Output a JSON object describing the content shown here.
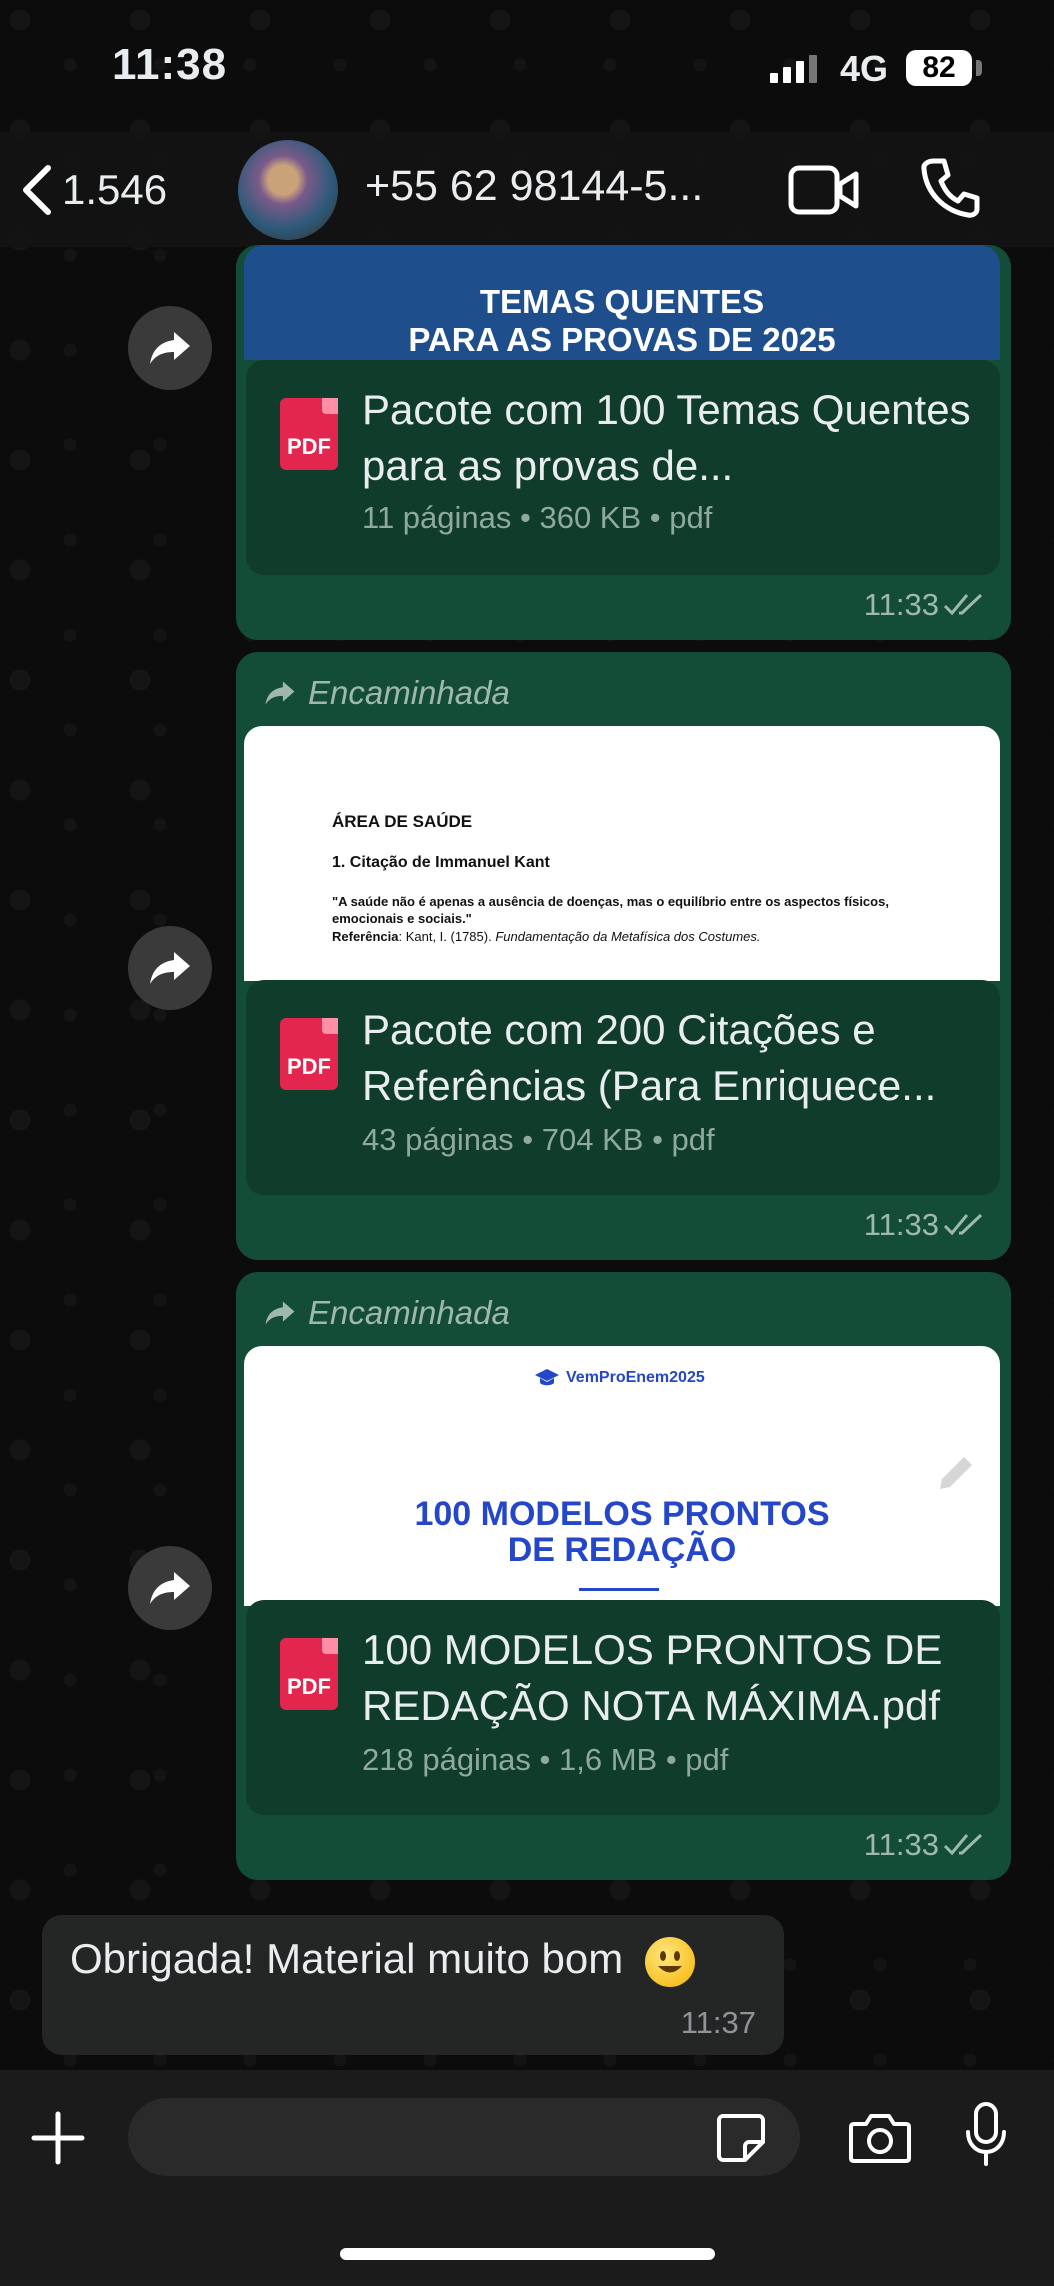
{
  "status_bar": {
    "time": "11:38",
    "network": "4G",
    "battery": "82"
  },
  "header": {
    "back_count": "1.546",
    "contact_name": "+55 62 98144-5..."
  },
  "messages": [
    {
      "preview_banner": [
        "TEMAS QUENTES",
        "PARA AS PROVAS DE 2025"
      ],
      "doc_title": "Pacote com 100 Temas Quentes para as provas de...",
      "doc_meta": "11 páginas • 360 KB • pdf",
      "time": "11:33"
    },
    {
      "forwarded_label": "Encaminhada",
      "preview_lines": {
        "heading": "ÁREA DE SAÚDE",
        "subheading": "1. Citação de Immanuel Kant",
        "quote": "\"A saúde não é apenas a ausência de doenças, mas o equilíbrio entre os aspectos físicos, emocionais e sociais.\"",
        "reference_label": "Referência",
        "reference_text": ": Kant, I. (1785). ",
        "reference_italic": "Fundamentação da Metafísica dos Costumes."
      },
      "doc_title": "Pacote com 200 Citações e Referências (Para Enriquece...",
      "doc_meta": "43 páginas • 704 KB • pdf",
      "time": "11:33"
    },
    {
      "forwarded_label": "Encaminhada",
      "preview_brand": "VemProEnem2025",
      "preview_title": [
        "100 MODELOS PRONTOS",
        "DE REDAÇÃO"
      ],
      "doc_title": "100 MODELOS PRONTOS DE REDAÇÃO NOTA MÁXIMA.pdf",
      "doc_meta": "218 páginas • 1,6 MB • pdf",
      "time": "11:33"
    }
  ],
  "received": {
    "text": "Obrigada! Material muito bom",
    "emoji": "😃",
    "time": "11:37"
  },
  "pdf_label": "PDF",
  "colors": {
    "sent_bubble": "#144d37",
    "received_bubble": "#242626",
    "pdf_red": "#e2264d",
    "banner_blue": "#1f4e8c",
    "link_blue": "#2446c9"
  },
  "icons": [
    "chevron-left-icon",
    "video-camera-icon",
    "phone-icon",
    "forward-icon",
    "pdf-icon",
    "double-check-icon",
    "plus-icon",
    "sticker-icon",
    "camera-icon",
    "microphone-icon",
    "pencil-icon",
    "graduation-cap-icon"
  ]
}
